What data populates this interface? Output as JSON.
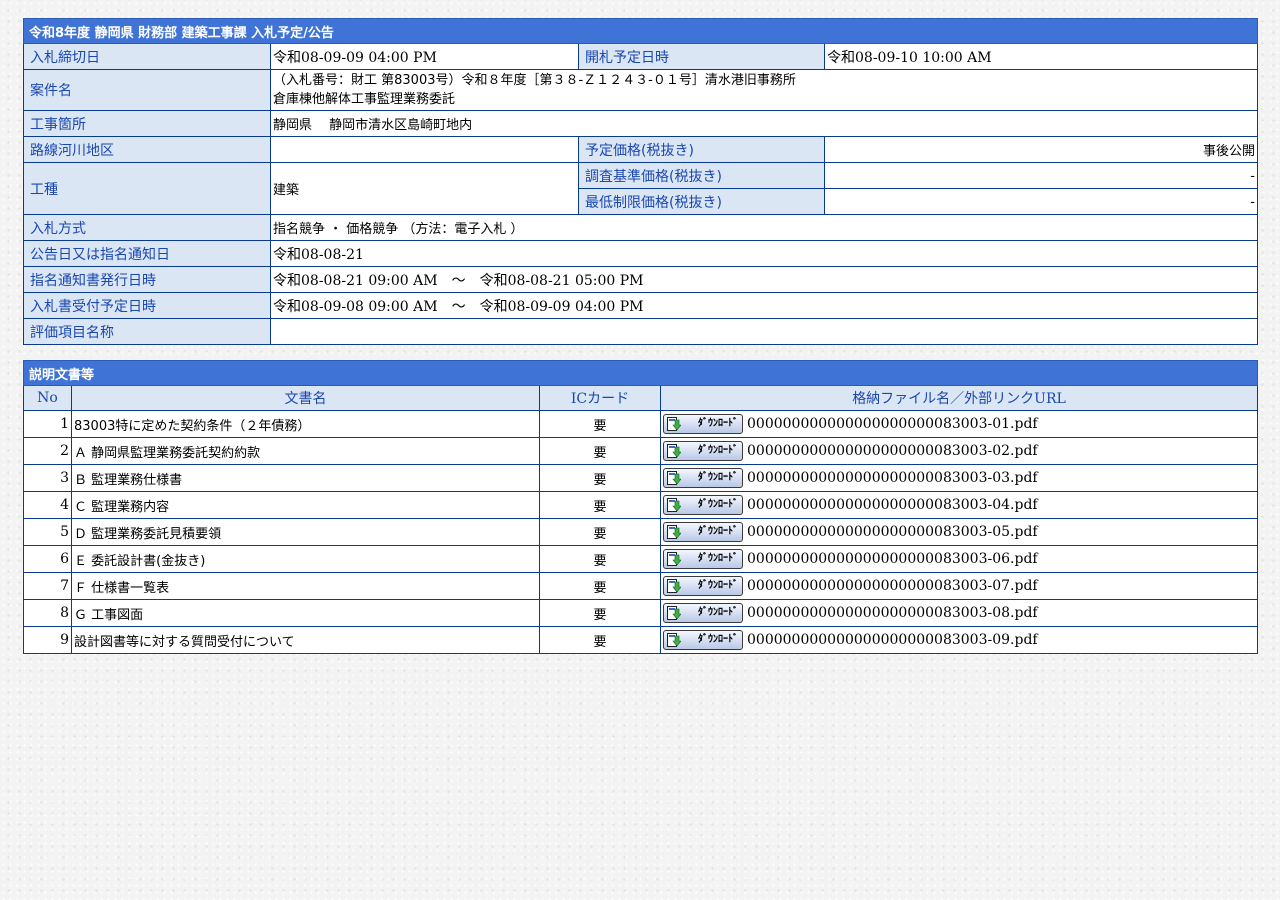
{
  "header": {
    "title": "令和8年度 静岡県 財務部 建築工事課 入札予定/公告"
  },
  "info": {
    "deadline_label": "入札締切日",
    "deadline_value": "令和08-09-09 04:00 PM",
    "opening_label": "開札予定日時",
    "opening_value": "令和08-09-10 10:00 AM",
    "project_label": "案件名",
    "project_line1": "（入札番号：財工 第83003号）令和８年度［第３８-Ｚ１２４３-０１号］清水港旧事務所",
    "project_line2": "倉庫棟他解体工事監理業務委託",
    "location_label": "工事箇所",
    "location_value": "静岡県　 静岡市清水区島崎町地内",
    "route_label": "路線河川地区",
    "route_value": "",
    "planned_price_label": "予定価格(税抜き)",
    "planned_price_value": "事後公開",
    "type_label": "工種",
    "type_value": "建築",
    "survey_price_label": "調査基準価格(税抜き)",
    "survey_price_value": "-",
    "min_price_label": "最低制限価格(税抜き)",
    "min_price_value": "-",
    "method_label": "入札方式",
    "method_value": "指名競争 ・ 価格競争 （方法：電子入札 ）",
    "notice_date_label": "公告日又は指名通知日",
    "notice_date_value": "令和08-08-21",
    "issue_label": "指名通知書発行日時",
    "issue_value": "令和08-08-21 09:00 AM　～　令和08-08-21 05:00 PM",
    "receipt_label": "入札書受付予定日時",
    "receipt_value": "令和08-09-08 09:00 AM　～　令和08-09-09 04:00 PM",
    "eval_label": "評価項目名称",
    "eval_value": ""
  },
  "docs": {
    "title": "説明文書等",
    "col_no": "No",
    "col_name": "文書名",
    "col_ic": "ICカード",
    "col_file": "格納ファイル名／外部リンクURL",
    "download_label": "ﾀﾞｳﾝﾛｰﾄﾞ",
    "rows": [
      {
        "no": "1",
        "name": "83003特に定めた契約条件（２年債務）",
        "ic": "要",
        "file": "000000000000000000000083003-01.pdf"
      },
      {
        "no": "2",
        "name": "Ａ 静岡県監理業務委託契約約款",
        "ic": "要",
        "file": "000000000000000000000083003-02.pdf"
      },
      {
        "no": "3",
        "name": "Ｂ 監理業務仕様書",
        "ic": "要",
        "file": "000000000000000000000083003-03.pdf"
      },
      {
        "no": "4",
        "name": "Ｃ 監理業務内容",
        "ic": "要",
        "file": "000000000000000000000083003-04.pdf"
      },
      {
        "no": "5",
        "name": "Ｄ 監理業務委託見積要領",
        "ic": "要",
        "file": "000000000000000000000083003-05.pdf"
      },
      {
        "no": "6",
        "name": "Ｅ 委託設計書(金抜き)",
        "ic": "要",
        "file": "000000000000000000000083003-06.pdf"
      },
      {
        "no": "7",
        "name": "Ｆ 仕様書一覧表",
        "ic": "要",
        "file": "000000000000000000000083003-07.pdf"
      },
      {
        "no": "8",
        "name": "Ｇ 工事図面",
        "ic": "要",
        "file": "000000000000000000000083003-08.pdf"
      },
      {
        "no": "9",
        "name": "設計図書等に対する質問受付について",
        "ic": "要",
        "file": "000000000000000000000083003-09.pdf"
      }
    ]
  }
}
